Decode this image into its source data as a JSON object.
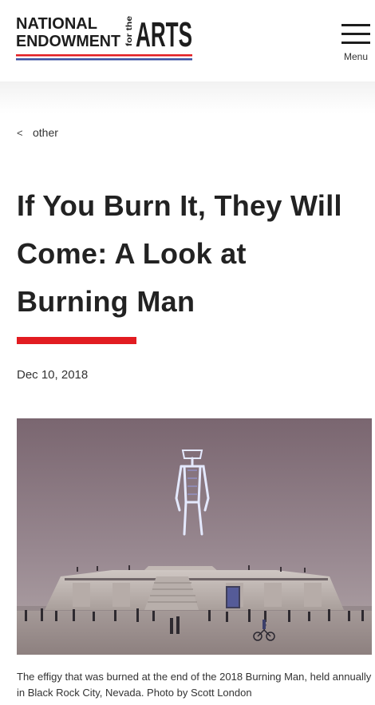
{
  "header": {
    "logo": {
      "line1": "NATIONAL",
      "line2": "ENDOWMENT",
      "small": "for the",
      "big": "ARTS"
    },
    "menu_label": "Menu"
  },
  "breadcrumb": {
    "chevron": "<",
    "label": "other"
  },
  "article": {
    "title": "If You Burn It, They Will Come: A Look at Burning Man",
    "date": "Dec 10, 2018",
    "caption": "The effigy that was burned at the end of the 2018 Burning Man, held annually in Black Rock City, Nevada. Photo by Scott London"
  },
  "colors": {
    "accent_red": "#e21c21",
    "accent_blue": "#3a4fa0",
    "text_dark": "#222222"
  },
  "icons": {
    "menu": "hamburger-icon",
    "back": "chevron-left-icon"
  }
}
